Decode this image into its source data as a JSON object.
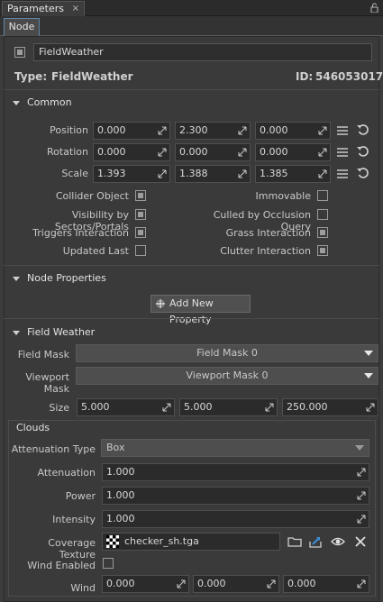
{
  "tab": {
    "title": "Parameters",
    "close": "×"
  },
  "subtab": {
    "label": "Node"
  },
  "node": {
    "name": "FieldWeather",
    "enabled": true,
    "type_label": "Type:",
    "type_value": "FieldWeather",
    "id_label": "ID:",
    "id_value": "546053017"
  },
  "common": {
    "title": "Common",
    "position": {
      "label": "Position",
      "x": "0.000",
      "y": "2.300",
      "z": "0.000"
    },
    "rotation": {
      "label": "Rotation",
      "x": "0.000",
      "y": "0.000",
      "z": "0.000"
    },
    "scale": {
      "label": "Scale",
      "x": "1.393",
      "y": "1.388",
      "z": "1.385"
    },
    "flags": {
      "collider": {
        "label": "Collider Object",
        "checked": true
      },
      "immovable": {
        "label": "Immovable",
        "checked": false
      },
      "visibility": {
        "label": "Visibility by Sectors/Portals",
        "checked": true
      },
      "culled": {
        "label": "Culled by Occlusion Query",
        "checked": false
      },
      "triggers": {
        "label": "Triggers Interaction",
        "checked": true
      },
      "grass": {
        "label": "Grass Interaction",
        "checked": true
      },
      "updated": {
        "label": "Updated Last",
        "checked": false
      },
      "clutter": {
        "label": "Clutter Interaction",
        "checked": true
      }
    }
  },
  "node_properties": {
    "title": "Node Properties",
    "add_button": "Add New Property"
  },
  "field_weather": {
    "title": "Field Weather",
    "field_mask": {
      "label": "Field Mask",
      "value": "Field Mask 0"
    },
    "viewport_mask": {
      "label": "Viewport Mask",
      "value": "Viewport Mask 0"
    },
    "size": {
      "label": "Size",
      "x": "5.000",
      "y": "5.000",
      "z": "250.000"
    },
    "clouds": {
      "title": "Clouds",
      "attenuation_type": {
        "label": "Attenuation Type",
        "value": "Box"
      },
      "attenuation": {
        "label": "Attenuation",
        "value": "1.000"
      },
      "power": {
        "label": "Power",
        "value": "1.000"
      },
      "intensity": {
        "label": "Intensity",
        "value": "1.000"
      },
      "coverage_texture": {
        "label": "Coverage Texture",
        "value": "checker_sh.tga"
      },
      "wind_enabled": {
        "label": "Wind Enabled",
        "checked": false
      },
      "wind": {
        "label": "Wind",
        "x": "0.000",
        "y": "0.000",
        "z": "0.000"
      }
    }
  }
}
